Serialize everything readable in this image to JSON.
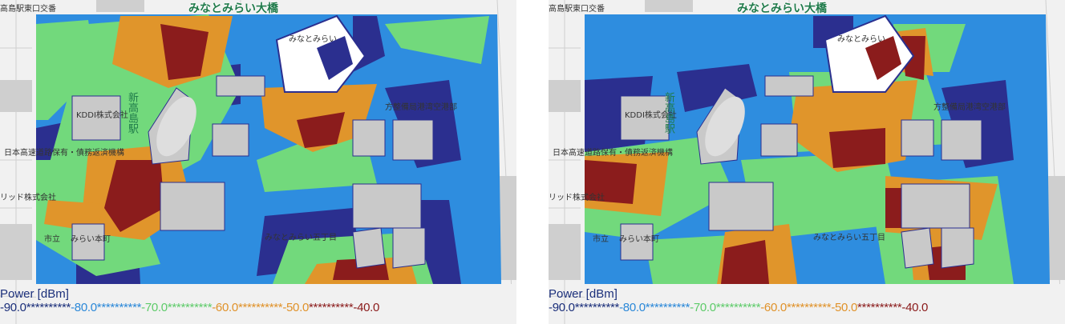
{
  "map_labels": {
    "station_intersection": "高島駅東口交番",
    "bridge": "みなとみらい大橋",
    "minatomirai_building": "みなとみらい",
    "kddi": "KDDI株式会社",
    "japan_road": "日本高速道路保有・債務返済機構",
    "lid_company": "リッド株式会社",
    "shin_takashima": "新高島駅",
    "minatomirai_5": "みなとみらい五丁目",
    "city_school": "市立",
    "mirai_hon": "みらい本町",
    "debt_org": "方整備局港湾空港部"
  },
  "legend": {
    "title": "Power [dBm]",
    "ticks": [
      "-90.0",
      "-80.0",
      "-70.0",
      "-60.0",
      "-50.0",
      "-40.0"
    ],
    "separator": "**********",
    "colors": [
      "#2b2f8f",
      "#2b88d8",
      "#6fd67a",
      "#e0922a",
      "#8a1a1a",
      "#8a1a1a"
    ]
  },
  "colors": {
    "level_1": "#2b2f8f",
    "level_2": "#2e8ddf",
    "level_3": "#72d97c",
    "level_4": "#e0952b",
    "level_5": "#8b1c1c"
  }
}
